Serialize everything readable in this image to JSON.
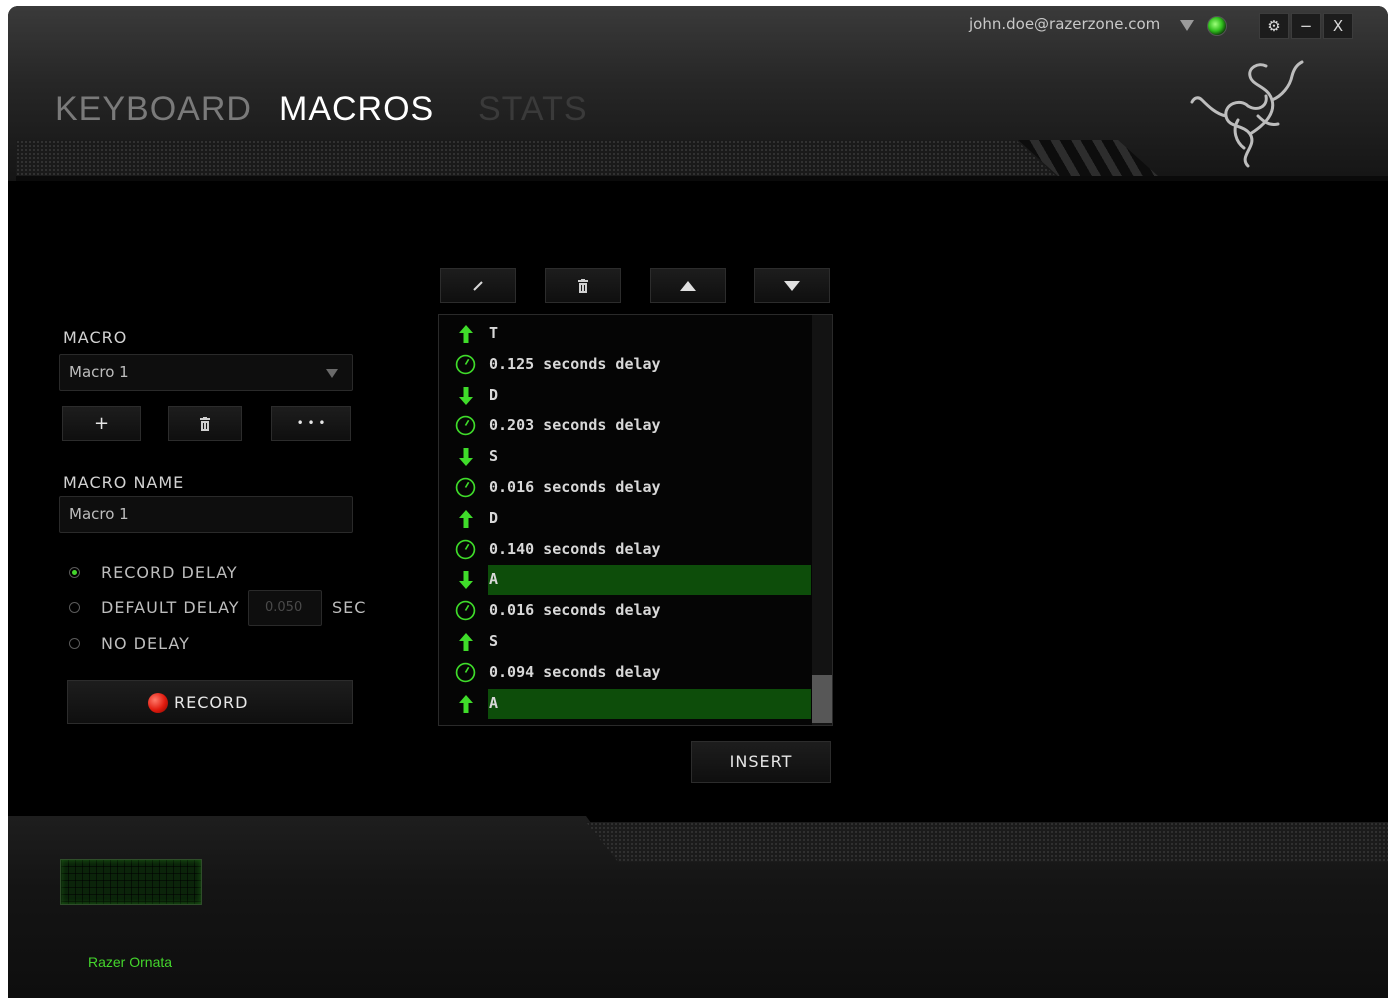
{
  "header": {
    "tabs": [
      {
        "label": "KEYBOARD"
      },
      {
        "label": "MACROS"
      },
      {
        "label": "STATS"
      }
    ],
    "active_tab": "MACROS",
    "account_email": "john.doe@razerzone.com",
    "window_controls": {
      "settings": "⚙",
      "minimize": "−",
      "close": "X"
    }
  },
  "macro_panel": {
    "macro_label": "MACRO",
    "macro_selected": "Macro 1",
    "add_label": "+",
    "more_label": "• • •",
    "macro_name_label": "MACRO NAME",
    "macro_name_value": "Macro 1",
    "options": [
      {
        "label": "RECORD DELAY",
        "selected": true
      },
      {
        "label": "DEFAULT DELAY",
        "selected": false
      },
      {
        "label": "NO DELAY",
        "selected": false
      }
    ],
    "default_delay_value": "0.050",
    "delay_unit": "SEC",
    "record_label": "RECORD"
  },
  "macro_list": {
    "rows": [
      {
        "type": "up",
        "text": "T",
        "highlighted": false
      },
      {
        "type": "delay",
        "text": "0.125 seconds delay",
        "highlighted": false
      },
      {
        "type": "down",
        "text": "D",
        "highlighted": false
      },
      {
        "type": "delay",
        "text": "0.203 seconds delay",
        "highlighted": false
      },
      {
        "type": "down",
        "text": "S",
        "highlighted": false
      },
      {
        "type": "delay",
        "text": "0.016 seconds delay",
        "highlighted": false
      },
      {
        "type": "up",
        "text": "D",
        "highlighted": false
      },
      {
        "type": "delay",
        "text": "0.140 seconds delay",
        "highlighted": false
      },
      {
        "type": "down",
        "text": "A",
        "highlighted": true
      },
      {
        "type": "delay",
        "text": "0.016 seconds delay",
        "highlighted": false
      },
      {
        "type": "up",
        "text": "S",
        "highlighted": false
      },
      {
        "type": "delay",
        "text": "0.094 seconds delay",
        "highlighted": false
      },
      {
        "type": "up",
        "text": "A",
        "highlighted": true
      }
    ],
    "insert_label": "INSERT"
  },
  "footer": {
    "device_name": "Razer Ornata"
  },
  "colors": {
    "accent": "#44d62c",
    "highlight": "#0d4d0a",
    "background": "#000000"
  }
}
